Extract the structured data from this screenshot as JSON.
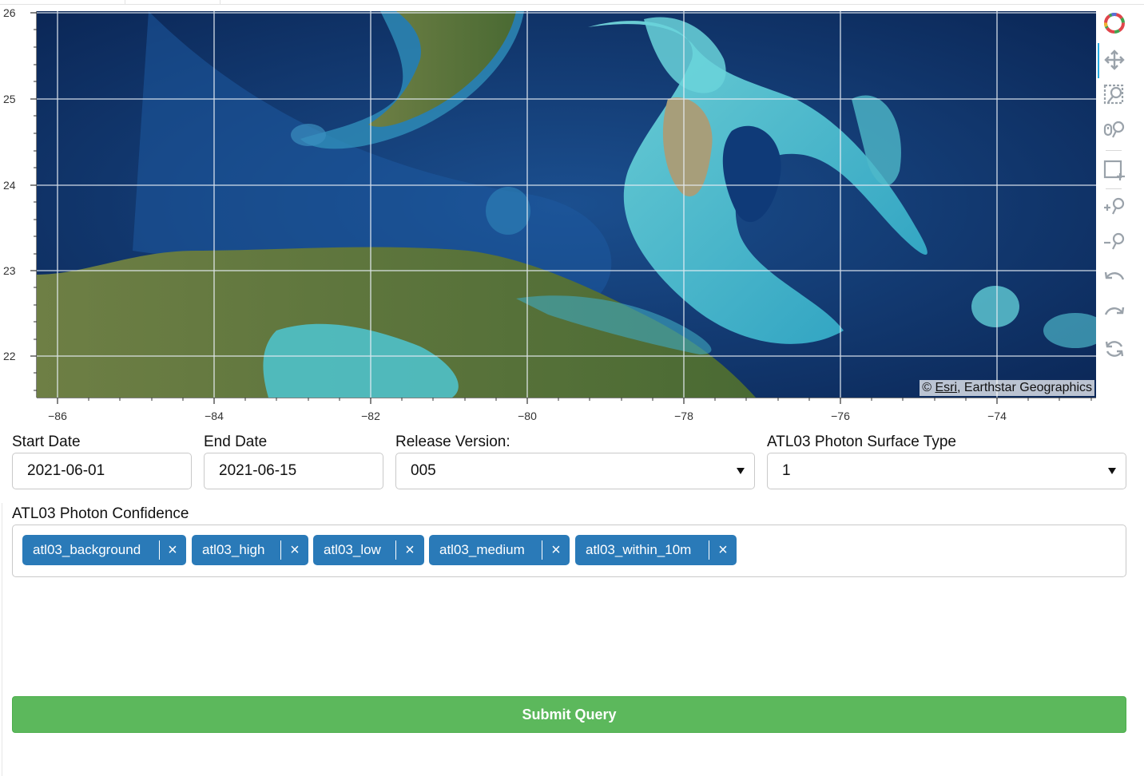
{
  "map": {
    "y_ticks": [
      "26",
      "25",
      "24",
      "23",
      "22"
    ],
    "x_ticks": [
      "−86",
      "−84",
      "−82",
      "−80",
      "−78",
      "−76",
      "−74"
    ],
    "attribution_prefix": "© ",
    "attribution_link": "Esri",
    "attribution_suffix": ", Earthstar Geographics",
    "colors": {
      "ocean_deep": "#0d2f63",
      "ocean_mid": "#1f5aa0",
      "shallow": "#3fb8c8",
      "land": "#5c7a3a",
      "grid": "#e8eef5"
    }
  },
  "toolbar": {
    "tools": [
      "bokeh-logo-icon",
      "pan-icon",
      "box-zoom-icon",
      "wheel-zoom-icon",
      "box-select-icon",
      "zoom-in-icon",
      "zoom-out-icon",
      "undo-icon",
      "redo-icon",
      "reset-icon"
    ]
  },
  "form": {
    "start_date": {
      "label": "Start Date",
      "value": "2021-06-01"
    },
    "end_date": {
      "label": "End Date",
      "value": "2021-06-15"
    },
    "release_version": {
      "label": "Release Version:",
      "value": "005"
    },
    "surface_type": {
      "label": "ATL03 Photon Surface Type",
      "value": "1"
    },
    "confidence": {
      "label": "ATL03 Photon Confidence",
      "chips": [
        "atl03_background",
        "atl03_high",
        "atl03_low",
        "atl03_medium",
        "atl03_within_10m"
      ],
      "chip_color": "#2a7ab8"
    },
    "submit_label": "Submit Query",
    "submit_color": "#5cb85c"
  }
}
